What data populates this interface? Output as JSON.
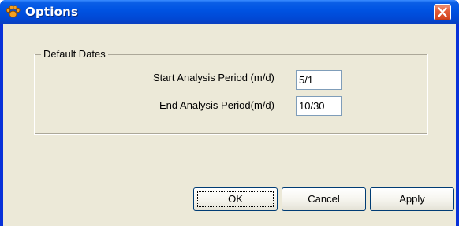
{
  "window": {
    "title": "Options",
    "icon": "paw-icon",
    "close_icon": "close-icon"
  },
  "group": {
    "legend": "Default Dates",
    "fields": [
      {
        "label": "Start Analysis Period (m/d)",
        "value": "5/1"
      },
      {
        "label": "End Analysis Period(m/d)",
        "value": "10/30"
      }
    ]
  },
  "buttons": {
    "ok": "OK",
    "cancel": "Cancel",
    "apply": "Apply"
  },
  "colors": {
    "titlebar": "#0054e3",
    "client": "#ece9d8",
    "close": "#e35d38"
  }
}
